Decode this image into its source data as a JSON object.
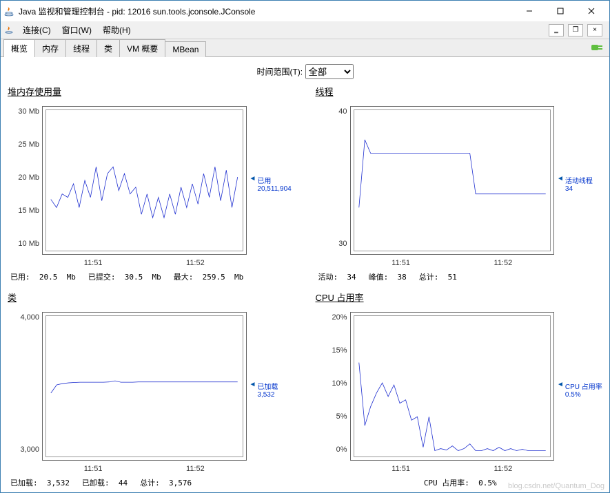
{
  "window": {
    "title": "Java 监视和管理控制台 - pid: 12016 sun.tools.jconsole.JConsole"
  },
  "menubar": {
    "connect": "连接(C)",
    "window": "窗口(W)",
    "help": "帮助(H)"
  },
  "tabs": {
    "overview": "概览",
    "memory": "内存",
    "threads": "线程",
    "classes": "类",
    "vm": "VM 概要",
    "mbean": "MBean"
  },
  "time_range": {
    "label": "时间范围(T):",
    "value": "全部"
  },
  "chart_data": [
    {
      "id": "heap",
      "title": "堆内存使用量",
      "type": "line",
      "ylabel": "Mb",
      "y_ticks": [
        "30 Mb",
        "25 Mb",
        "20 Mb",
        "15 Mb",
        "10 Mb"
      ],
      "ylim": [
        10,
        30
      ],
      "x_ticks": [
        "11:51",
        "11:52"
      ],
      "side_label_title": "已用",
      "side_label_value": "20,511,904",
      "stats": [
        {
          "k": "已用:",
          "v": "20.5  Mb"
        },
        {
          "k": "已提交:",
          "v": "30.5  Mb"
        },
        {
          "k": "最大:",
          "v": "259.5  Mb"
        }
      ],
      "values": [
        17.2,
        16,
        18,
        17.5,
        19.5,
        16,
        20,
        17.5,
        22,
        17,
        21,
        22,
        18.5,
        21,
        18,
        19,
        15,
        18,
        14.5,
        17.5,
        14.5,
        18,
        15,
        19,
        16,
        19.5,
        16.5,
        21,
        17.5,
        22,
        17,
        21.5,
        16,
        20.5
      ]
    },
    {
      "id": "threads",
      "title": "线程",
      "type": "line",
      "ylabel": "",
      "y_ticks": [
        "40",
        "",
        "",
        "",
        "30"
      ],
      "ylim": [
        30,
        40
      ],
      "x_ticks": [
        "11:51",
        "11:52"
      ],
      "side_label_title": "活动线程",
      "side_label_value": "34",
      "stats": [
        {
          "k": "活动:",
          "v": "34"
        },
        {
          "k": "峰值:",
          "v": "38"
        },
        {
          "k": "总计:",
          "v": "51"
        }
      ],
      "values": [
        33,
        38,
        37,
        37,
        37,
        37,
        37,
        37,
        37,
        37,
        37,
        37,
        37,
        37,
        37,
        37,
        37,
        37,
        37,
        37,
        34,
        34,
        34,
        34,
        34,
        34,
        34,
        34,
        34,
        34,
        34,
        34,
        34
      ]
    },
    {
      "id": "classes",
      "title": "类",
      "type": "line",
      "ylabel": "",
      "y_ticks": [
        "4,000",
        "",
        "",
        "",
        "3,000"
      ],
      "ylim": [
        3000,
        4000
      ],
      "x_ticks": [
        "11:51",
        "11:52"
      ],
      "side_label_title": "已加载",
      "side_label_value": "3,532",
      "stats": [
        {
          "k": "已加载:",
          "v": "3,532"
        },
        {
          "k": "已卸载:",
          "v": "44"
        },
        {
          "k": "总计:",
          "v": "3,576"
        }
      ],
      "values": [
        3450,
        3510,
        3520,
        3525,
        3528,
        3530,
        3530,
        3530,
        3530,
        3530,
        3532,
        3540,
        3530,
        3530,
        3530,
        3532,
        3532,
        3532,
        3532,
        3532,
        3532,
        3532,
        3532,
        3532,
        3532,
        3532,
        3532,
        3532,
        3532,
        3532,
        3532,
        3532,
        3532
      ]
    },
    {
      "id": "cpu",
      "title": "CPU 占用率",
      "type": "line",
      "ylabel": "%",
      "y_ticks": [
        "20%",
        "15%",
        "10%",
        "5%",
        "0%"
      ],
      "ylim": [
        0,
        20
      ],
      "x_ticks": [
        "11:51",
        "11:52"
      ],
      "side_label_title": "CPU 占用率",
      "side_label_value": "0.5%",
      "stats": [
        {
          "k": "CPU 占用率:",
          "v": "0.5%"
        }
      ],
      "values": [
        13.5,
        4.2,
        7,
        9,
        10.5,
        8.5,
        10.2,
        7.5,
        8,
        5,
        5.5,
        1,
        5.5,
        0.5,
        0.8,
        0.6,
        1.2,
        0.5,
        0.8,
        1.5,
        0.5,
        0.5,
        0.8,
        0.5,
        1,
        0.5,
        0.8,
        0.5,
        0.7,
        0.5,
        0.5,
        0.5,
        0.5
      ]
    }
  ],
  "watermark": "blog.csdn.net/Quantum_Dog"
}
